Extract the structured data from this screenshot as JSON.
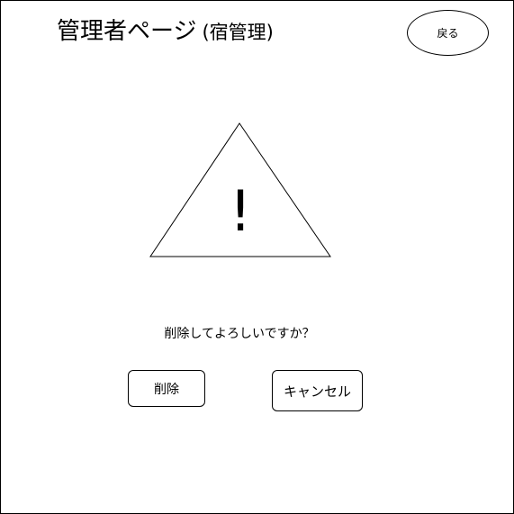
{
  "header": {
    "title": "管理者ページ",
    "subtitle": "(宿管理)",
    "back_label": "戻る"
  },
  "dialog": {
    "warning_icon": "warning-triangle-icon",
    "warning_mark": "!",
    "message": "削除してよろしいですか？",
    "delete_label": "削除",
    "cancel_label": "キャンセル"
  },
  "colors": {
    "background": "#ffffff",
    "border": "#000000",
    "text": "#000000"
  }
}
